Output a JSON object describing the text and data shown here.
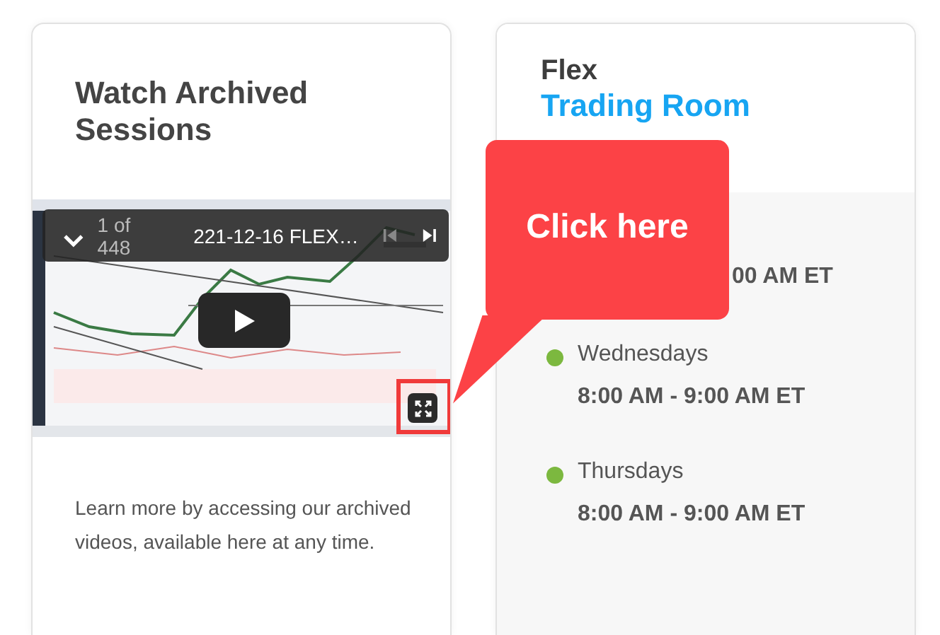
{
  "archive_card": {
    "title": "Watch Archived Sessions",
    "video": {
      "counter": "1 of 448",
      "title": "221-12-16 FLEX…",
      "previous_disabled": true,
      "fullscreen_highlighted": true
    },
    "description": "Learn more by accessing our archived videos, available here at any time."
  },
  "schedule_card": {
    "title": "Flex",
    "subtitle": "Trading Room",
    "sessions": [
      {
        "kind": "partial",
        "time": "00 AM ET"
      },
      {
        "kind": "full",
        "day": "Wednesdays",
        "time": "8:00 AM - 9:00 AM ET",
        "color": "#7cb83f"
      },
      {
        "kind": "full",
        "day": "Thursdays",
        "time": "8:00 AM - 9:00 AM ET",
        "color": "#7cb83f"
      }
    ]
  },
  "callout": {
    "text": "Click here"
  }
}
